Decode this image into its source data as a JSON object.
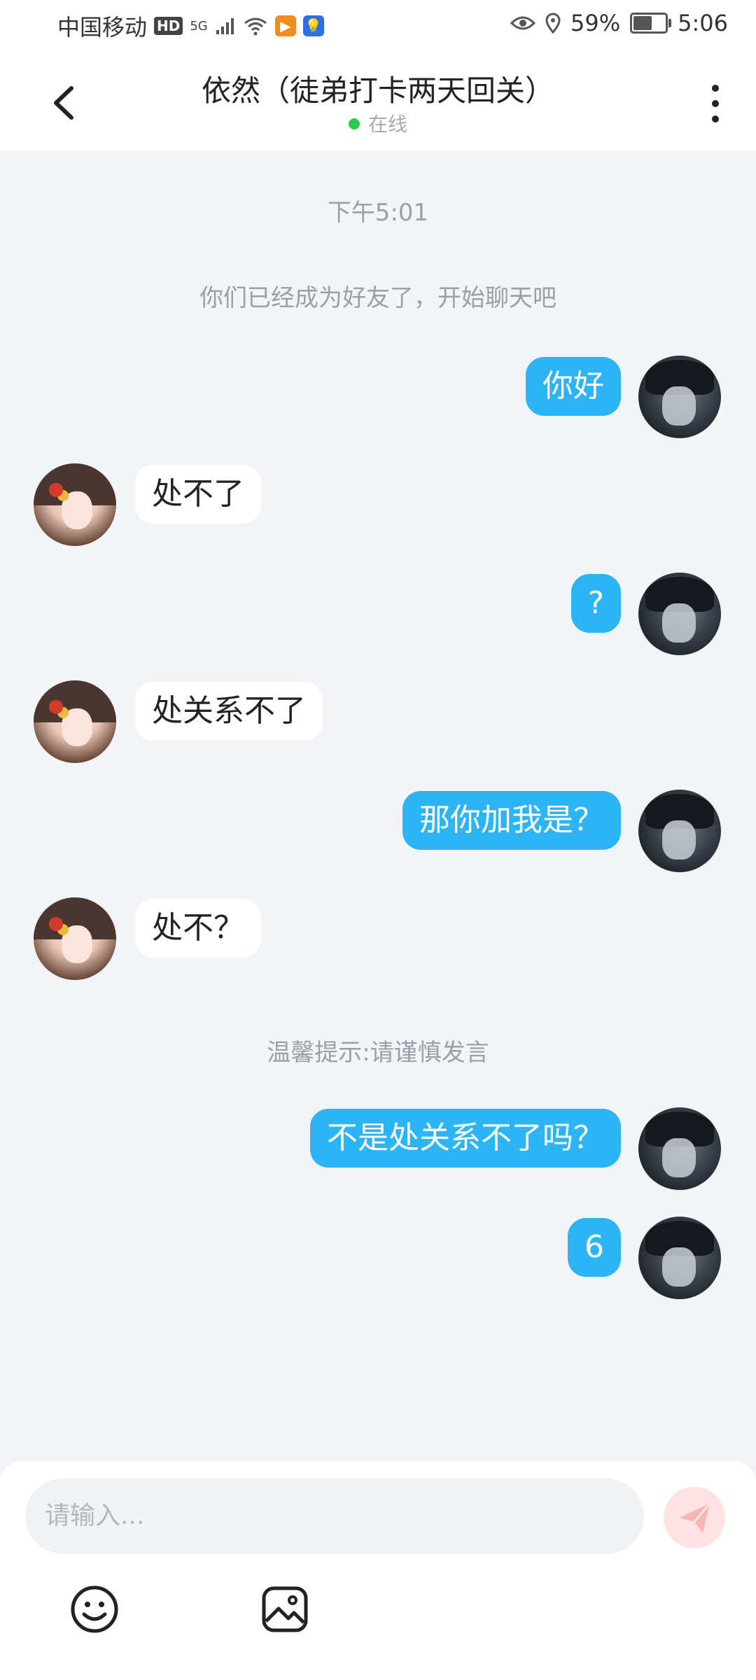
{
  "status_bar": {
    "carrier": "中国移动",
    "hd_badge": "HD",
    "network": "5G",
    "battery_percent": "59%",
    "time": "5:06",
    "battery_level": 0.59
  },
  "header": {
    "title": "依然（徒弟打卡两天回关）",
    "status": "在线"
  },
  "chat": {
    "timestamp": "下午5:01",
    "friend_notice": "你们已经成为好友了，开始聊天吧",
    "warm_tip": "温馨提示:请谨慎发言",
    "messages": [
      {
        "sender": "me",
        "text": "你好"
      },
      {
        "sender": "her",
        "text": "处不了"
      },
      {
        "sender": "me",
        "text": "?"
      },
      {
        "sender": "her",
        "text": "处关系不了"
      },
      {
        "sender": "me",
        "text": "那你加我是？"
      },
      {
        "sender": "her",
        "text": "处不？"
      },
      {
        "sender": "me",
        "text": "不是处关系不了吗？"
      },
      {
        "sender": "me",
        "text": "6"
      }
    ]
  },
  "composer": {
    "placeholder": "请输入..."
  },
  "colors": {
    "my_bubble": "#2db4f5",
    "her_bubble": "#ffffff",
    "online_dot": "#2ec84a",
    "send_button": "#fde3e3"
  }
}
